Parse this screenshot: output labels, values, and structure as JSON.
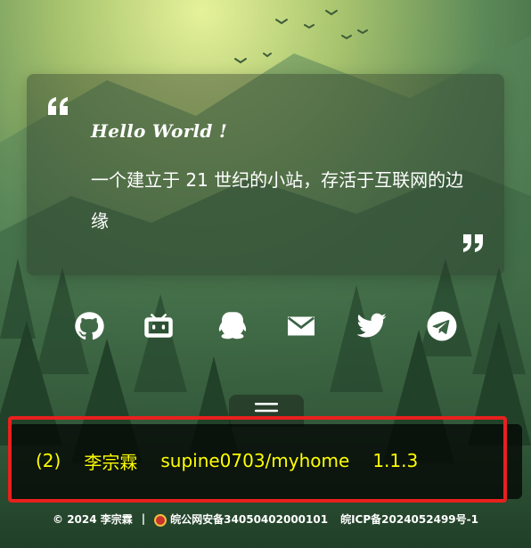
{
  "quote": {
    "greeting": "Hello World !",
    "intro": "一个建立于 21 世纪的小站，存活于互联网的边缘"
  },
  "socials": [
    {
      "name": "github-icon"
    },
    {
      "name": "bilibili-icon"
    },
    {
      "name": "qq-icon"
    },
    {
      "name": "email-icon"
    },
    {
      "name": "twitter-icon"
    },
    {
      "name": "telegram-icon"
    }
  ],
  "footer": {
    "index": "(2)",
    "author": "李宗霖",
    "repo": "supine0703/myhome",
    "version": "1.1.3",
    "highlight_color": "#ffff00",
    "annotation_color": "#e8201e"
  },
  "copyright": {
    "text": "© 2024 李宗霖",
    "separator": "|",
    "police_record": "皖公网安备34050402000101",
    "icp_record": "皖ICP备2024052499号-1"
  }
}
